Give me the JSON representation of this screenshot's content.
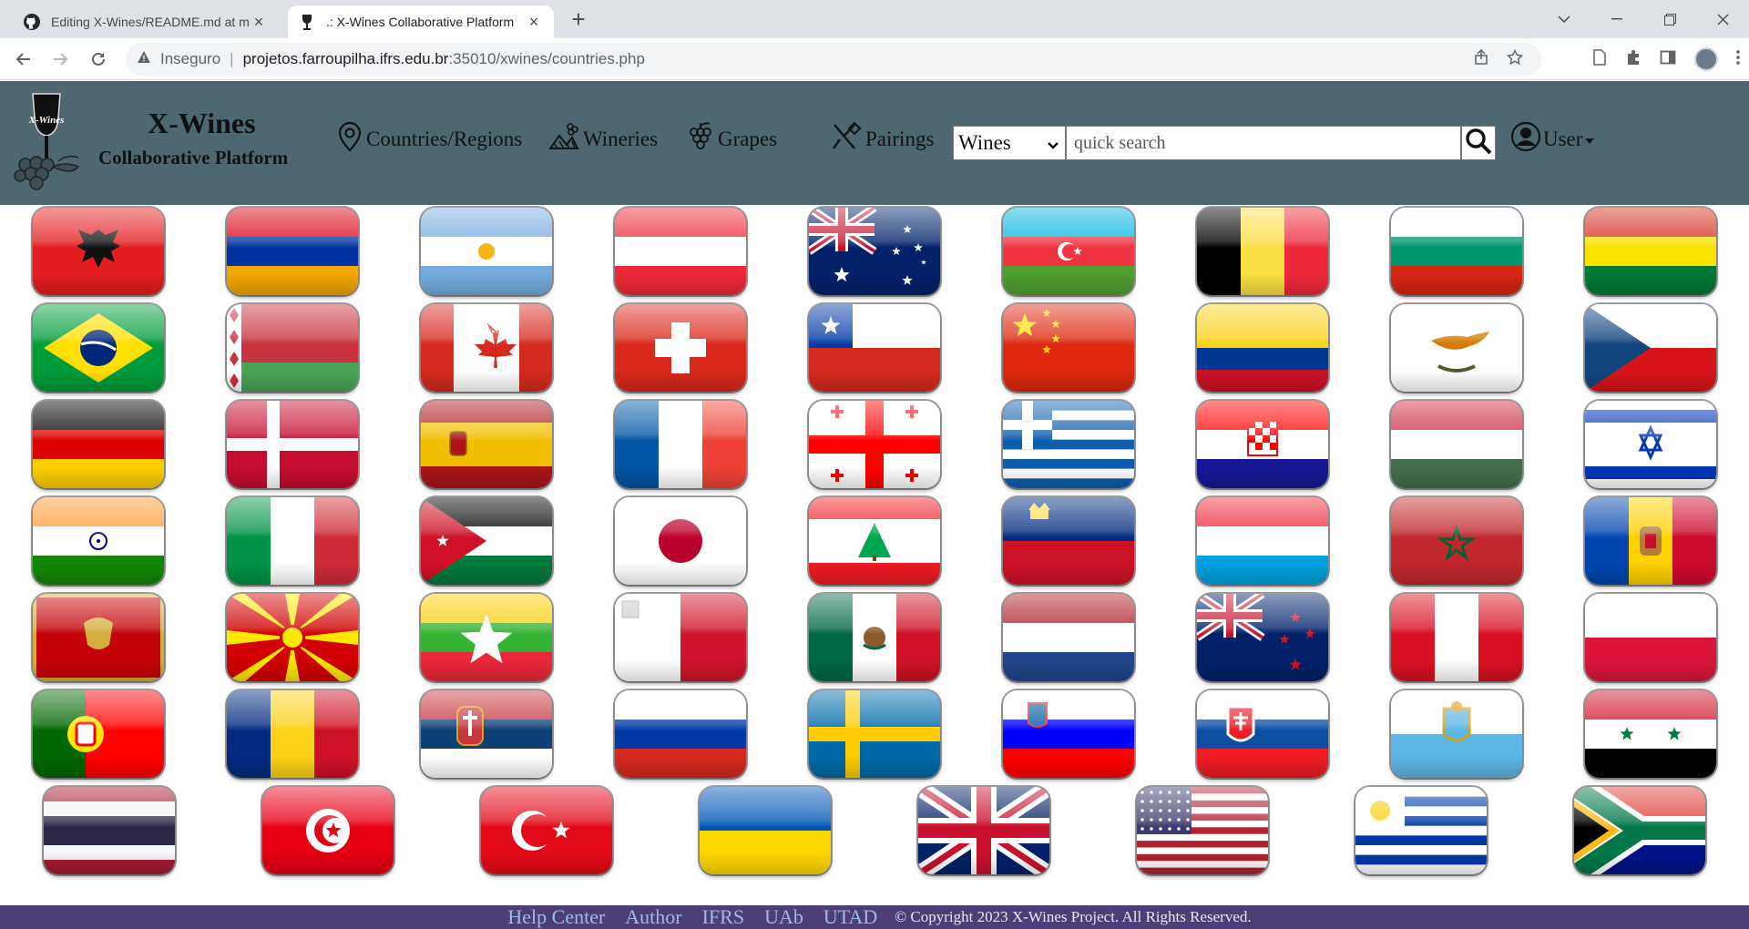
{
  "browser": {
    "tabs": [
      {
        "title": "Editing X-Wines/README.md at m",
        "icon": "github-icon"
      },
      {
        "title": ".: X-Wines Collaborative Platform",
        "icon": "wine-glass-icon"
      }
    ],
    "security_label": "Inseguro",
    "url_host": "projetos.farroupilha.ifrs.edu.br",
    "url_path": ":35010/xwines/countries.php"
  },
  "header": {
    "brand_title": "X-Wines",
    "brand_subtitle": "Collaborative Platform",
    "logo_text": "X-Wines",
    "menu": [
      {
        "label": "Countries/Regions",
        "icon": "map-pin-icon"
      },
      {
        "label": "Wineries",
        "icon": "vineyard-icon"
      },
      {
        "label": "Grapes",
        "icon": "grapes-icon"
      },
      {
        "label": "Pairings",
        "icon": "utensils-icon"
      }
    ],
    "search_type": "Wines",
    "search_placeholder": "quick search",
    "user_label": "User"
  },
  "flags": [
    "Albania",
    "Armenia",
    "Argentina",
    "Austria",
    "Australia",
    "Azerbaijan",
    "Belgium",
    "Bulgaria",
    "Bolivia",
    "Brazil",
    "Belarus",
    "Canada",
    "Switzerland",
    "Chile",
    "China",
    "Colombia",
    "Cyprus",
    "Czech Republic",
    "Germany",
    "Denmark",
    "Spain",
    "France",
    "Georgia",
    "Greece",
    "Croatia",
    "Hungary",
    "Israel",
    "India",
    "Italy",
    "Jordan",
    "Japan",
    "Lebanon",
    "Liechtenstein",
    "Luxembourg",
    "Morocco",
    "Moldova",
    "Montenegro",
    "North Macedonia",
    "Myanmar",
    "Malta",
    "Mexico",
    "Netherlands",
    "New Zealand",
    "Peru",
    "Poland",
    "Portugal",
    "Romania",
    "Serbia",
    "Russia",
    "Sweden",
    "Slovenia",
    "Slovakia",
    "San Marino",
    "Syria",
    "Thailand",
    "Tunisia",
    "Turkey",
    "Ukraine",
    "United Kingdom",
    "United States",
    "Uruguay",
    "South Africa"
  ],
  "footer": {
    "links": [
      "Help Center",
      "Author",
      "IFRS",
      "UAb",
      "UTAD"
    ],
    "copyright": "© Copyright 2023 X-Wines Project. All Rights Reserved."
  }
}
